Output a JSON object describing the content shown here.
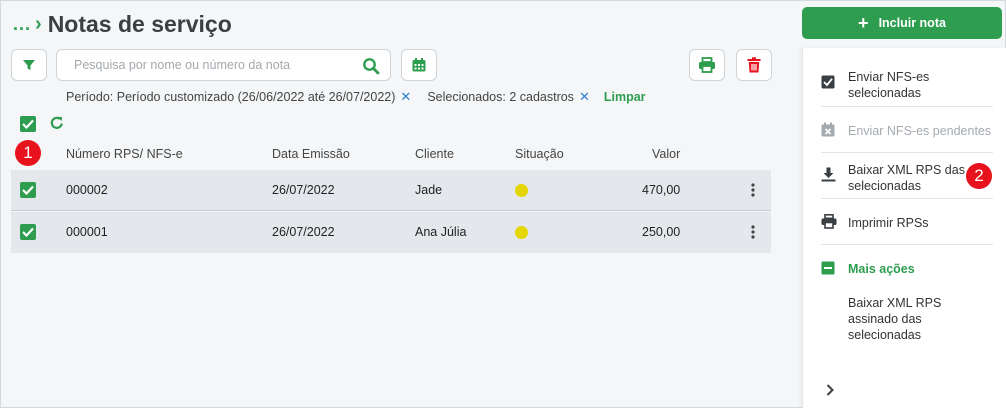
{
  "header": {
    "breadcrumb_dots": "...",
    "title": "Notas de serviço"
  },
  "toolbar": {
    "search_placeholder": "Pesquisa por nome ou número da nota"
  },
  "filters": {
    "period": "Período: Período customizado (26/06/2022 até 26/07/2022)",
    "selected": "Selecionados: 2 cadastros",
    "clear_label": "Limpar"
  },
  "badges": {
    "one": "1",
    "two": "2"
  },
  "table": {
    "columns": [
      "Número RPS/ NFS-e",
      "Data Emissão",
      "Cliente",
      "Situação",
      "Valor"
    ],
    "rows": [
      {
        "numero": "000002",
        "data": "26/07/2022",
        "cliente": "Jade",
        "valor": "470,00",
        "checked": true
      },
      {
        "numero": "000001",
        "data": "26/07/2022",
        "cliente": "Ana Júlia",
        "valor": "250,00",
        "checked": true
      }
    ]
  },
  "panel": {
    "primary_button": "Incluir nota",
    "items": [
      {
        "label": "Enviar NFS-es selecionadas",
        "icon": "checkbox-icon"
      },
      {
        "label": "Enviar NFS-es pendentes",
        "icon": "calendar-x-icon",
        "disabled": true
      },
      {
        "label": "Baixar XML RPS das selecionadas",
        "icon": "download-icon"
      },
      {
        "label": "Imprimir RPSs",
        "icon": "printer-icon"
      }
    ],
    "more_actions": "Mais ações",
    "more_item": "Baixar XML RPS assinado das selecionadas"
  },
  "colors": {
    "accent": "#2e9d4f",
    "danger": "#e8121c",
    "status_pending": "#e6d600",
    "link_blue": "#2d7ed1"
  }
}
